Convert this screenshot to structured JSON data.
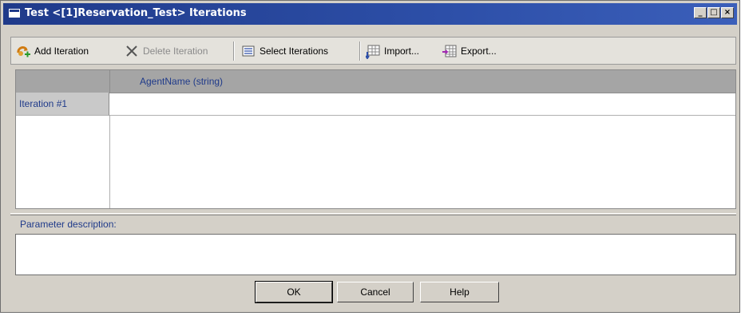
{
  "window": {
    "title": "Test <[1]Reservation_Test> Iterations",
    "controls": {
      "minimize": "_",
      "maximize": "□",
      "close": "×"
    }
  },
  "toolbar": {
    "add_iteration": "Add Iteration",
    "delete_iteration": "Delete Iteration",
    "select_iterations": "Select Iterations",
    "import": "Import...",
    "export": "Export..."
  },
  "grid": {
    "columns": [
      "AgentName (string)"
    ],
    "rows": [
      {
        "label": "Iteration #1",
        "values": [
          ""
        ]
      }
    ]
  },
  "description": {
    "label": "Parameter description:",
    "value": ""
  },
  "buttons": {
    "ok": "OK",
    "cancel": "Cancel",
    "help": "Help"
  },
  "colors": {
    "titlebar": "#1f3a8a",
    "header_text": "#1f3a8a",
    "grid_header": "#a5a5a5",
    "dialog_bg": "#d4d0c8"
  },
  "icons": {
    "add_iteration": "add-iteration-icon",
    "delete_iteration": "delete-x-icon",
    "select_iterations": "list-icon",
    "import": "import-table-icon",
    "export": "export-table-icon"
  }
}
